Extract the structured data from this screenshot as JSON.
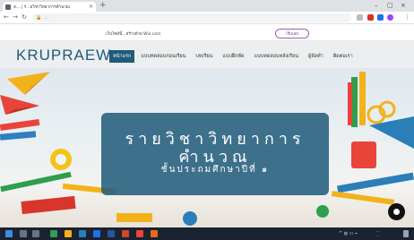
{
  "browser": {
    "tab_title": "ส… | ร…ยวิชาวิทยาการคำนวณ",
    "tab_close": "×",
    "new_tab": "+",
    "window_controls": [
      "–",
      "▢",
      "×"
    ],
    "url": "…"
  },
  "wix_banner": {
    "text": "เว็บไซต์นี้…สร้างด้วย Wix.com",
    "button_label": "เริ่มเลย"
  },
  "site": {
    "logo": "KRUPRAEW",
    "nav": [
      {
        "label": "หน้าแรก",
        "active": true
      },
      {
        "label": "แบบทดสอบก่อนเรียน",
        "active": false
      },
      {
        "label": "บทเรียน",
        "active": false
      },
      {
        "label": "แบบฝึกหัด",
        "active": false
      },
      {
        "label": "แบบทดสอบหลังเรียน",
        "active": false
      },
      {
        "label": "ผู้จัดทำ",
        "active": false
      },
      {
        "label": "ติดต่อเรา",
        "active": false
      }
    ]
  },
  "hero": {
    "title": "รายวิชาวิทยาการคำนวณ",
    "subtitle": "ชั้นประถมศึกษาปีที่ ๑"
  },
  "colors": {
    "primary": "#1f5b7a",
    "nav_active_bg": "#1f5b7a",
    "header_bg": "#eceeef",
    "taskbar_bg": "#1b2230"
  },
  "icons": {
    "chat": "chat-bubble-icon",
    "back": "back-arrow-icon",
    "forward": "forward-arrow-icon",
    "reload": "reload-icon",
    "lock": "lock-icon"
  }
}
